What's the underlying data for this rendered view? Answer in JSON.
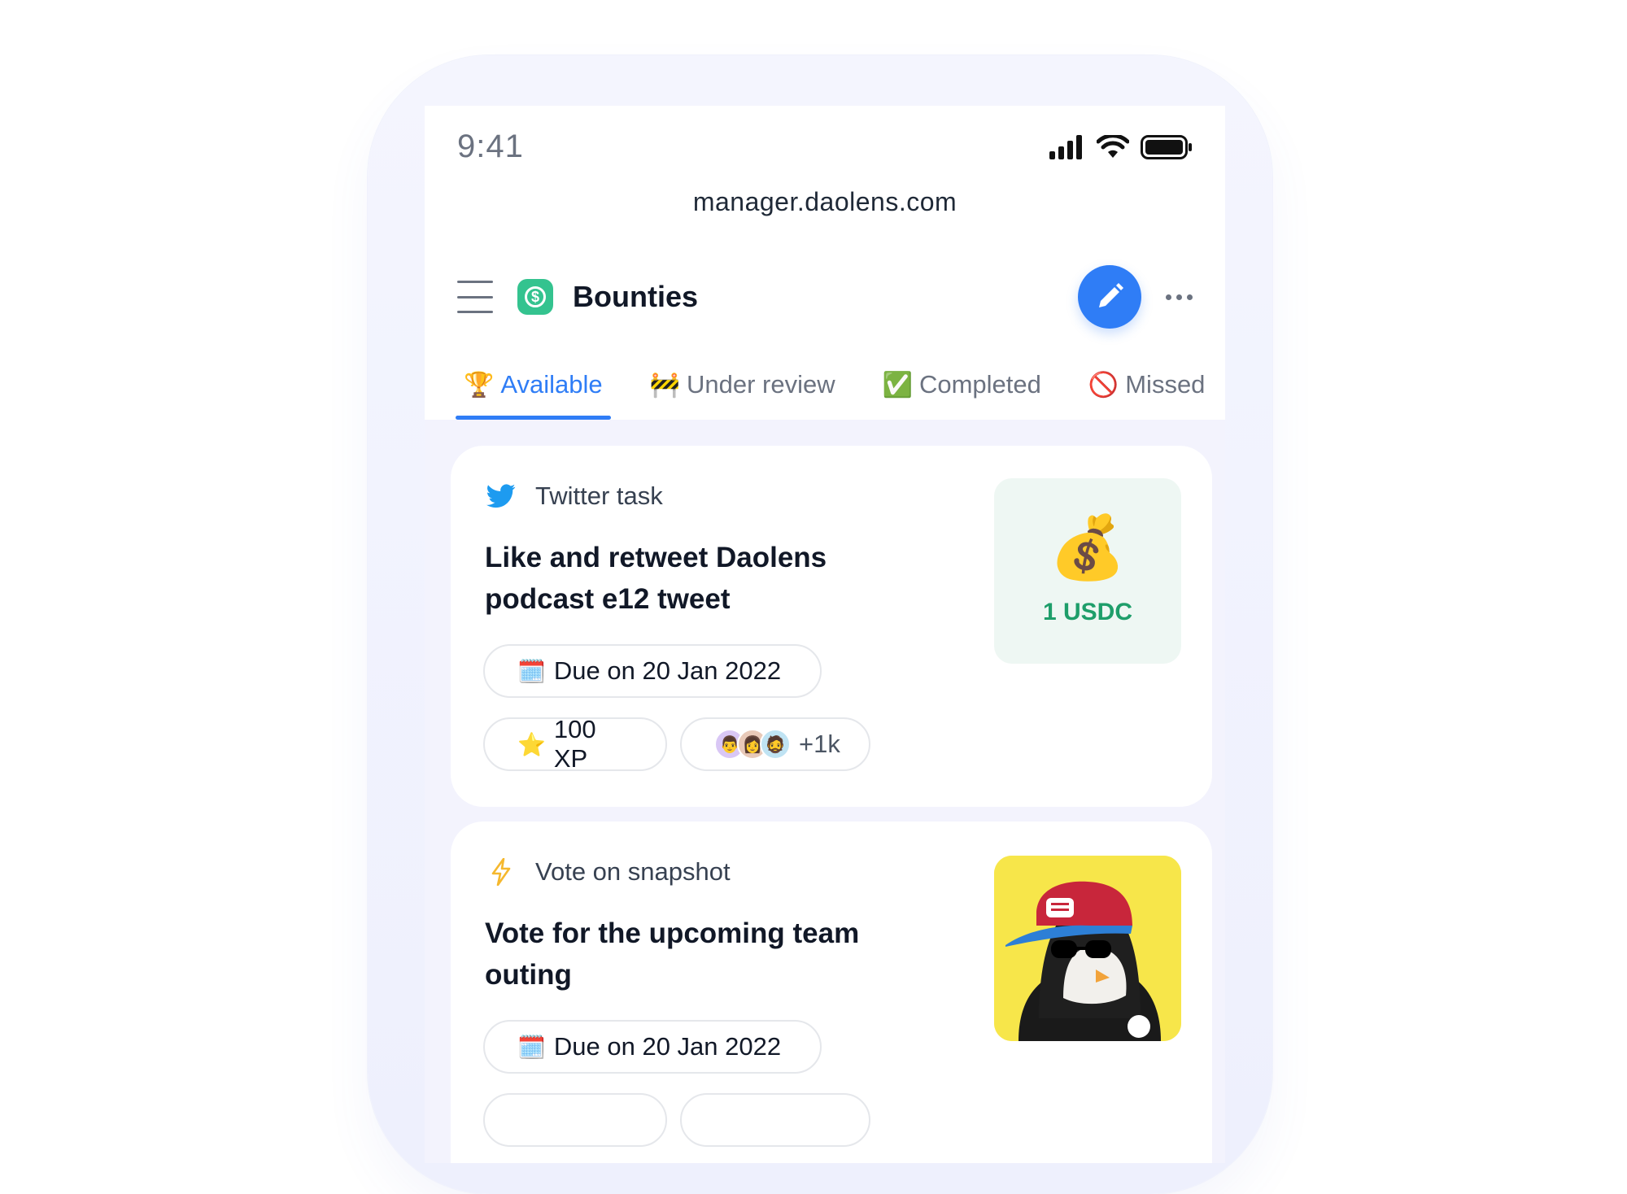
{
  "status_bar": {
    "time": "9:41"
  },
  "browser": {
    "url": "manager.daolens.com"
  },
  "appbar": {
    "title": "Bounties",
    "logo_icon": "dollar-badge-icon",
    "accent": "#2f7df6",
    "logo_color": "#34c38f"
  },
  "tabs": [
    {
      "emoji": "🏆",
      "label": "Available",
      "active": true
    },
    {
      "emoji": "🚧",
      "label": "Under review",
      "active": false
    },
    {
      "emoji": "✅",
      "label": "Completed",
      "active": false
    },
    {
      "emoji": "🚫",
      "label": "Missed",
      "active": false
    }
  ],
  "cards": [
    {
      "type_icon": "twitter-icon",
      "type": "Twitter task",
      "title": "Like and retweet Daolens podcast e12 tweet",
      "due": "Due on 20 Jan 2022",
      "due_emoji": "🗓️",
      "xp": "100 XP",
      "xp_emoji": "⭐",
      "participants": "+1k",
      "reward_emoji": "💰",
      "reward": "1 USDC"
    },
    {
      "type_icon": "lightning-icon",
      "type": "Vote on snapshot",
      "title": "Vote for the upcoming team outing",
      "due": "Due on 20 Jan 2022",
      "due_emoji": "🗓️",
      "reward_image": "penguin-nft-image"
    }
  ]
}
